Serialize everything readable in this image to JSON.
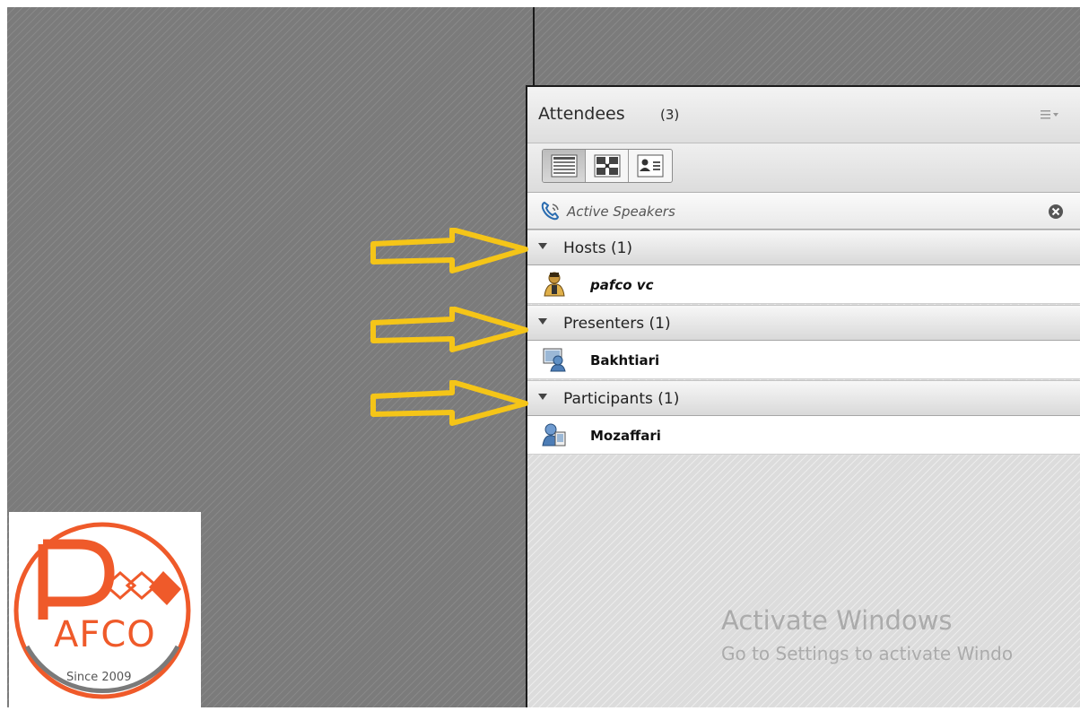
{
  "attendees_panel": {
    "title": "Attendees",
    "count": "(3)",
    "toolbar": {
      "buttons": [
        {
          "icon": "list-view-icon",
          "active": true
        },
        {
          "icon": "breakout-rooms-icon",
          "active": false
        },
        {
          "icon": "attendee-status-icon",
          "active": false
        }
      ]
    },
    "active_speakers_label": "Active Speakers",
    "sections": [
      {
        "label": "Hosts (1)",
        "members": [
          {
            "name": "pafco vc",
            "icon": "host-icon",
            "italic": true
          }
        ]
      },
      {
        "label": "Presenters (1)",
        "members": [
          {
            "name": "Bakhtiari",
            "icon": "presenter-icon",
            "italic": false
          }
        ]
      },
      {
        "label": "Participants (1)",
        "members": [
          {
            "name": "Mozaffari",
            "icon": "participant-icon",
            "italic": false
          }
        ]
      }
    ]
  },
  "watermark": {
    "line1": "Activate Windows",
    "line2": "Go to Settings to activate Windo"
  },
  "logo": {
    "letters": "PAFCO",
    "since": "Since 2009"
  },
  "colors": {
    "arrow": "#f5c518",
    "logo_orange": "#ef5a2a",
    "logo_gray": "#7a7a7a"
  }
}
